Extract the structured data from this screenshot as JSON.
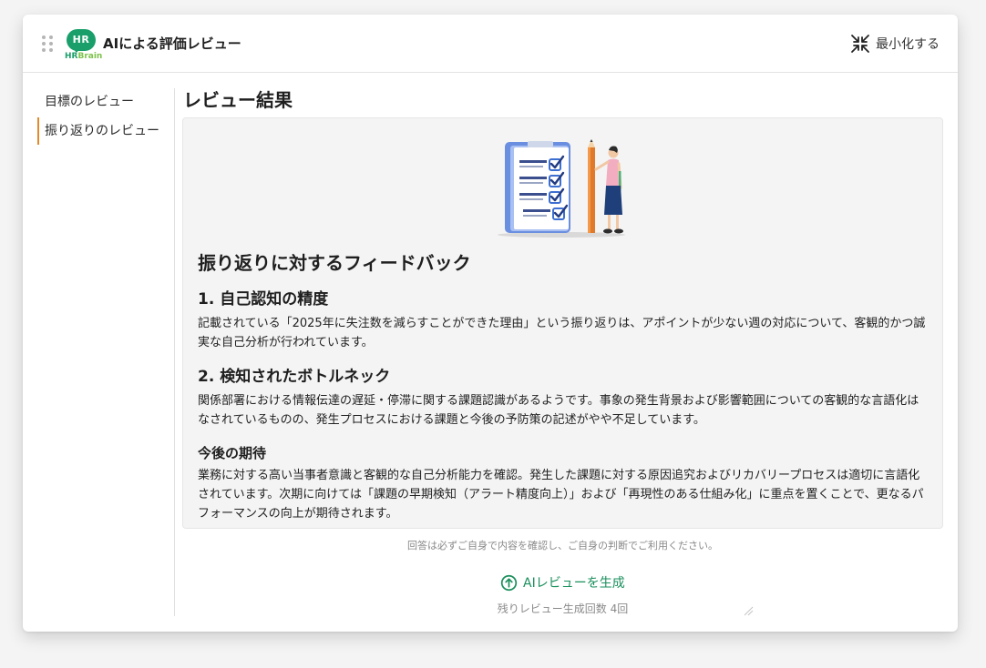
{
  "header": {
    "logo_badge": "HR",
    "logo_word_hr": "HR",
    "logo_word_brain": "Brain",
    "title": "AIによる評価レビュー",
    "minimize_label": "最小化する"
  },
  "sidebar": {
    "items": [
      {
        "label": "目標のレビュー",
        "active": false
      },
      {
        "label": "振り返りのレビュー",
        "active": true
      }
    ]
  },
  "main": {
    "title": "レビュー結果",
    "feedback": {
      "heading": "振り返りに対するフィードバック",
      "sections": [
        {
          "title": "1. 自己認知の精度",
          "body": "記載されている「2025年に失注数を減らすことができた理由」という振り返りは、アポイントが少ない週の対応について、客観的かつ誠実な自己分析が行われています。"
        },
        {
          "title": "2. 検知されたボトルネック",
          "body": "関係部署における情報伝達の遅延・停滞に関する課題認識があるようです。事象の発生背景および影響範囲についての客観的な言語化はなされているものの、発生プロセスにおける課題と今後の予防策の記述がやや不足しています。"
        },
        {
          "title": "今後の期待",
          "body": "業務に対する高い当事者意識と客観的な自己分析能力を確認。発生した課題に対する原因追究およびリカバリープロセスは適切に言語化されています。次期に向けては「課題の早期検知（アラート精度向上）」および「再現性のある仕組み化」に重点を置くことで、更なるパフォーマンスの向上が期待されます。"
        }
      ]
    },
    "disclaimer": "回答は必ずご自身で内容を確認し、ご自身の判断でご利用ください。",
    "generate_label": "AIレビューを生成",
    "remaining_label": "残りレビュー生成回数 4回"
  },
  "colors": {
    "brand_green": "#1a9f6a",
    "brand_light_green": "#7cc24a",
    "active_accent": "#e08a2c",
    "link_green": "#1a8f5c"
  },
  "icons": {
    "drag": "drag-handle-icon",
    "minimize": "minimize-arrows-icon",
    "generate": "arrow-up-circle-icon",
    "resize": "resize-grip-icon"
  }
}
